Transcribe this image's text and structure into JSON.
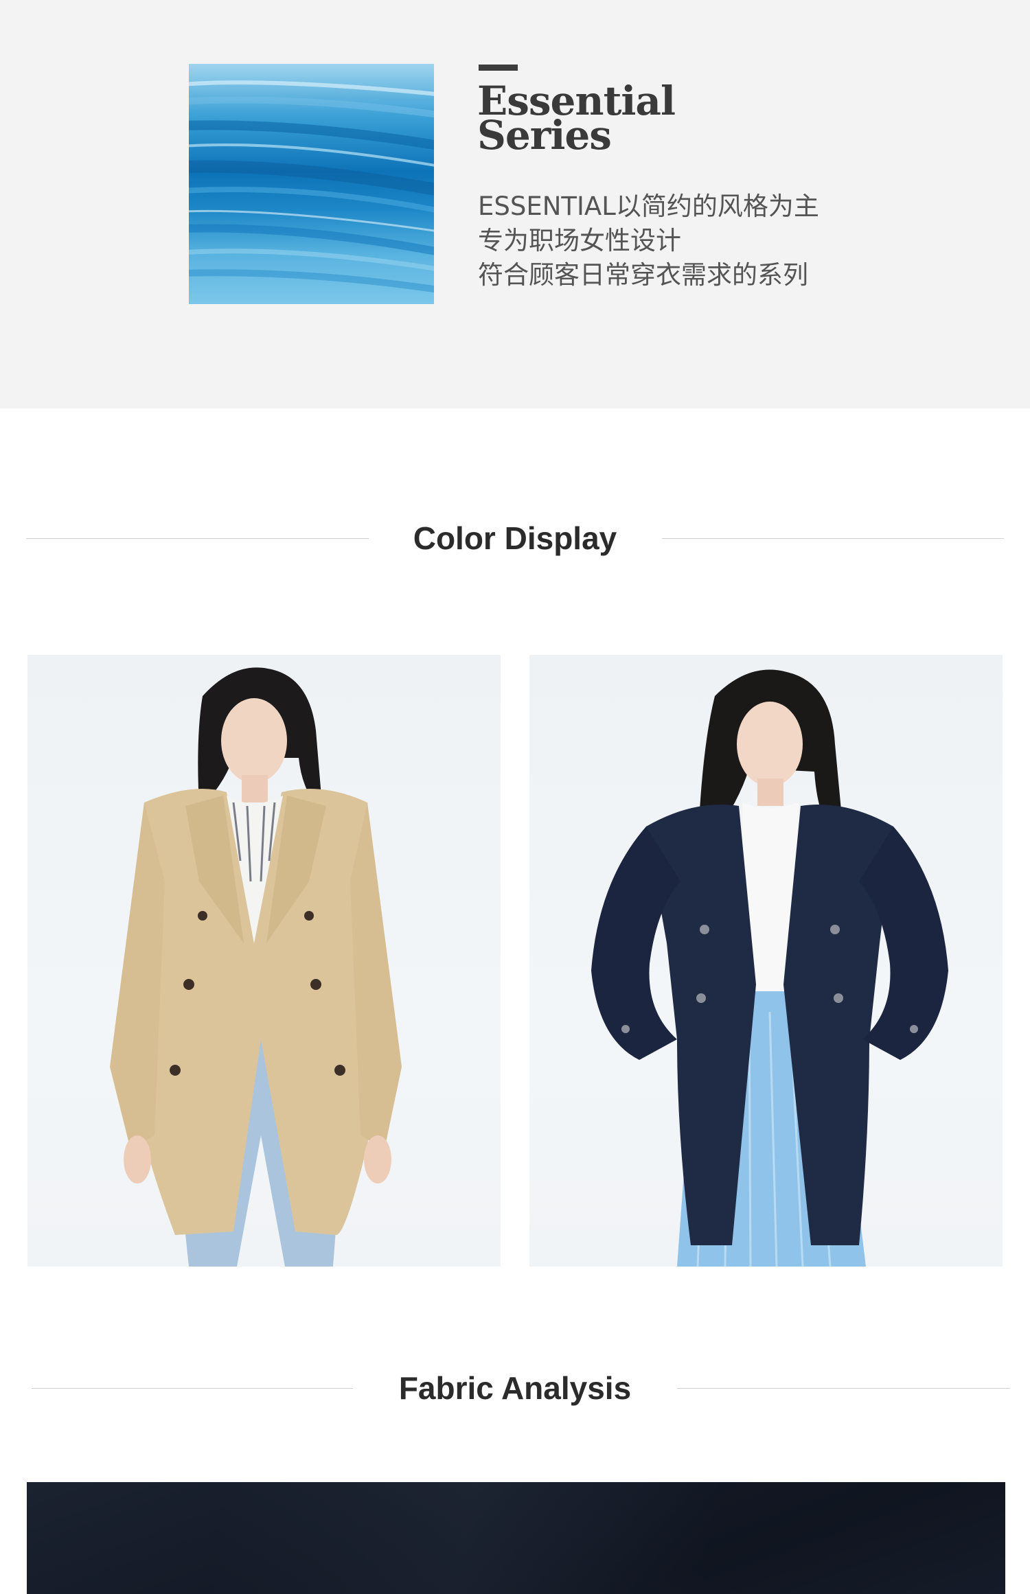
{
  "series": {
    "title_line1": "Essential",
    "title_line2": "Series",
    "description": [
      "ESSENTIAL以简约的风格为主",
      "专为职场女性设计",
      "符合顾客日常穿衣需求的系列"
    ],
    "swatch_icon": "blue-brushstroke-texture"
  },
  "color_display": {
    "heading": "Color Display",
    "photos": [
      {
        "icon": "khaki-trench-coat-model-photo",
        "coat_color": "#dcc49a"
      },
      {
        "icon": "navy-trench-coat-model-photo",
        "coat_color": "#1f2a45"
      }
    ]
  },
  "fabric_analysis": {
    "heading": "Fabric Analysis",
    "swatch_icon": "navy-fabric-closeup",
    "swatch_color": "#141a26"
  }
}
